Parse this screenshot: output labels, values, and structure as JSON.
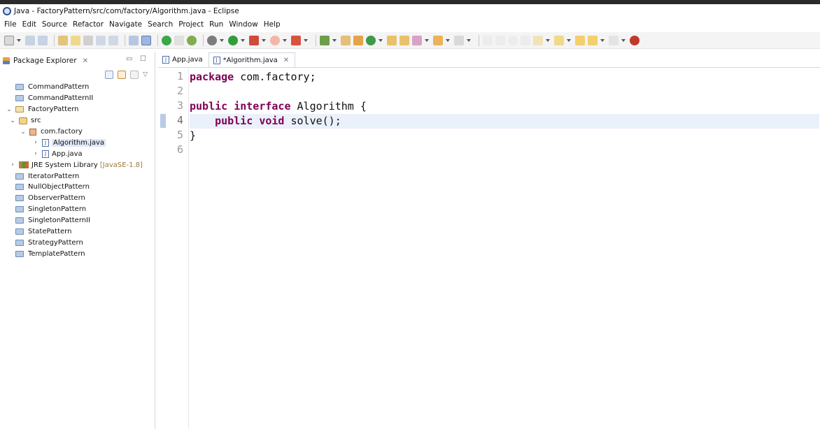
{
  "window": {
    "title": "Java - FactoryPattern/src/com/factory/Algorithm.java - Eclipse"
  },
  "menu": [
    "File",
    "Edit",
    "Source",
    "Refactor",
    "Navigate",
    "Search",
    "Project",
    "Run",
    "Window",
    "Help"
  ],
  "explorer": {
    "tab_label": "Package Explorer",
    "tree": [
      {
        "label": "CommandPattern",
        "indent": 0,
        "icon": "project-folder",
        "twisty": ""
      },
      {
        "label": "CommandPatternII",
        "indent": 0,
        "icon": "project-folder",
        "twisty": ""
      },
      {
        "label": "FactoryPattern",
        "indent": 0,
        "icon": "project-folder-open",
        "twisty": "expanded"
      },
      {
        "label": "src",
        "indent": 1,
        "icon": "source-folder",
        "twisty": "expanded"
      },
      {
        "label": "com.factory",
        "indent": 2,
        "icon": "package",
        "twisty": "expanded"
      },
      {
        "label": "Algorithm.java",
        "indent": 3,
        "icon": "java-file",
        "twisty": "collapsed",
        "selected": true
      },
      {
        "label": "App.java",
        "indent": 3,
        "icon": "java-file",
        "twisty": "collapsed"
      },
      {
        "label": "JRE System Library",
        "suffix": "[JavaSE-1.8]",
        "indent": 1,
        "icon": "library",
        "twisty": "collapsed"
      },
      {
        "label": "IteratorPattern",
        "indent": 0,
        "icon": "project-folder",
        "twisty": ""
      },
      {
        "label": "NullObjectPattern",
        "indent": 0,
        "icon": "project-folder",
        "twisty": ""
      },
      {
        "label": "ObserverPattern",
        "indent": 0,
        "icon": "project-folder",
        "twisty": ""
      },
      {
        "label": "SingletonPattern",
        "indent": 0,
        "icon": "project-folder",
        "twisty": ""
      },
      {
        "label": "SingletonPatternII",
        "indent": 0,
        "icon": "project-folder",
        "twisty": ""
      },
      {
        "label": "StatePattern",
        "indent": 0,
        "icon": "project-folder",
        "twisty": ""
      },
      {
        "label": "StrategyPattern",
        "indent": 0,
        "icon": "project-folder",
        "twisty": ""
      },
      {
        "label": "TemplatePattern",
        "indent": 0,
        "icon": "project-folder",
        "twisty": ""
      }
    ]
  },
  "editor": {
    "tabs": [
      {
        "label": "App.java",
        "active": false
      },
      {
        "label": "*Algorithm.java",
        "active": true
      }
    ],
    "current_line": 4,
    "lines": [
      {
        "no": "1",
        "tokens": [
          {
            "t": "package",
            "kw": true
          },
          {
            "t": " com.factory;",
            "kw": false
          }
        ]
      },
      {
        "no": "2",
        "tokens": []
      },
      {
        "no": "3",
        "tokens": [
          {
            "t": "public",
            "kw": true
          },
          {
            "t": " ",
            "kw": false
          },
          {
            "t": "interface",
            "kw": true
          },
          {
            "t": " Algorithm {",
            "kw": false
          }
        ]
      },
      {
        "no": "4",
        "tokens": [
          {
            "t": "    ",
            "kw": false
          },
          {
            "t": "public",
            "kw": true
          },
          {
            "t": " ",
            "kw": false
          },
          {
            "t": "void",
            "kw": true
          },
          {
            "t": " solve();",
            "kw": false
          }
        ]
      },
      {
        "no": "5",
        "tokens": [
          {
            "t": "}",
            "kw": false
          }
        ]
      },
      {
        "no": "6",
        "tokens": []
      }
    ]
  }
}
